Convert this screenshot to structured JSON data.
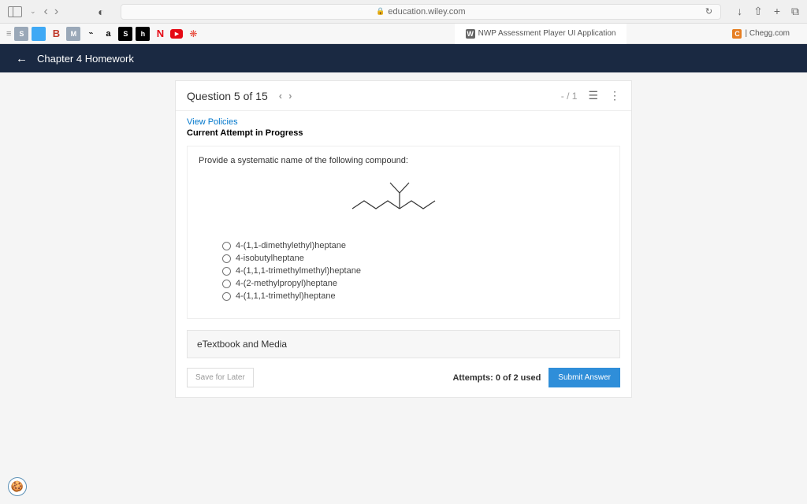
{
  "browser": {
    "url": "education.wiley.com",
    "tabs": [
      {
        "label": "NWP Assessment Player UI Application",
        "icon_bg": "#666",
        "icon_text": "W"
      },
      {
        "label": "| Chegg.com",
        "icon_bg": "#e67e22",
        "icon_text": "C"
      }
    ]
  },
  "header": {
    "title": "Chapter 4 Homework"
  },
  "question": {
    "label": "Question 5 of 15",
    "score": "- / 1",
    "policies_link": "View Policies",
    "status": "Current Attempt in Progress",
    "prompt": "Provide a systematic name of the following compound:",
    "options": [
      "4-(1,1-dimethylethyl)heptane",
      "4-isobutylheptane",
      "4-(1,1,1-trimethylmethyl)heptane",
      "4-(2-methylpropyl)heptane",
      "4-(1,1,1-trimethyl)heptane"
    ],
    "etextbook_label": "eTextbook and Media",
    "save_label": "Save for Later",
    "attempts_label": "Attempts: 0 of 2 used",
    "submit_label": "Submit Answer"
  }
}
